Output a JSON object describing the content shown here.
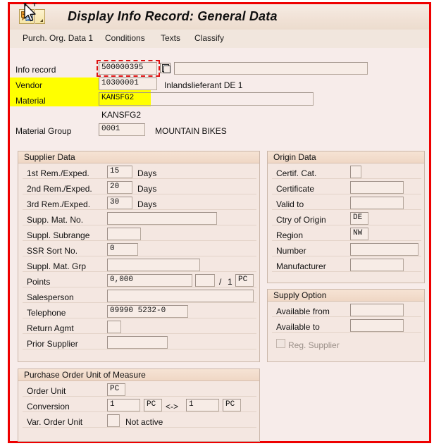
{
  "window": {
    "title": "Display Info Record: General Data",
    "system_icon": "sap-info-record-icon",
    "dropdown_icon": "chevron-down-icon"
  },
  "app_toolbar": {
    "items": [
      {
        "label": "Purch. Org. Data 1"
      },
      {
        "label": "Conditions"
      },
      {
        "label": "Texts"
      },
      {
        "label": "Classify"
      }
    ]
  },
  "header_fields": {
    "info_record": {
      "label": "Info record",
      "value": "500000395",
      "matchcode_icon": "matchcode-icon",
      "description": ""
    },
    "vendor": {
      "label": "Vendor",
      "value": "10300001",
      "description": "Inlandslieferant DE 1",
      "highlight": "#ffff00"
    },
    "material": {
      "label": "Material",
      "value": "KANSFG2",
      "description": "",
      "highlight": "#ffff00"
    },
    "material_text": "KANSFG2",
    "material_group": {
      "label": "Material Group",
      "value": "0001",
      "description": "MOUNTAIN BIKES"
    }
  },
  "supplier_data": {
    "title": "Supplier Data",
    "rows": [
      {
        "label": "1st Rem./Exped.",
        "value": "15",
        "suffix": "Days"
      },
      {
        "label": "2nd Rem./Exped.",
        "value": "20",
        "suffix": "Days"
      },
      {
        "label": "3rd Rem./Exped.",
        "value": "30",
        "suffix": "Days"
      },
      {
        "label": "Supp. Mat. No.",
        "value": "",
        "suffix": ""
      },
      {
        "label": "Suppl. Subrange",
        "value": "",
        "suffix": ""
      },
      {
        "label": "SSR Sort No.",
        "value": "0",
        "suffix": ""
      },
      {
        "label": "Suppl. Mat. Grp",
        "value": "",
        "suffix": ""
      },
      {
        "label": "Points",
        "value": "0,000",
        "suffix": ""
      },
      {
        "label": "Salesperson",
        "value": "",
        "suffix": ""
      },
      {
        "label": "Telephone",
        "value": "09990 5232-0",
        "suffix": ""
      },
      {
        "label": "Return Agmt",
        "value": "",
        "suffix": ""
      },
      {
        "label": "Prior Supplier",
        "value": "",
        "suffix": ""
      }
    ],
    "points_unit_value": "",
    "points_separator": "/",
    "points_denominator": "1",
    "points_uom": "PC"
  },
  "origin_data": {
    "title": "Origin Data",
    "rows": [
      {
        "label": "Certif. Cat.",
        "value": ""
      },
      {
        "label": "Certificate",
        "value": ""
      },
      {
        "label": "Valid to",
        "value": ""
      },
      {
        "label": "Ctry of Origin",
        "value": "DE"
      },
      {
        "label": "Region",
        "value": "NW"
      },
      {
        "label": "Number",
        "value": ""
      },
      {
        "label": "Manufacturer",
        "value": ""
      }
    ]
  },
  "supply_option": {
    "title": "Supply Option",
    "rows": [
      {
        "label": "Available from",
        "value": ""
      },
      {
        "label": "Available to",
        "value": ""
      }
    ],
    "checkbox": {
      "label": "Reg. Supplier",
      "checked": false,
      "enabled": false
    }
  },
  "po_unit_of_measure": {
    "title": "Purchase Order Unit of Measure",
    "order_unit": {
      "label": "Order Unit",
      "value": "PC"
    },
    "conversion": {
      "label": "Conversion",
      "numerator": "1",
      "numerator_uom": "PC",
      "operator": "<->",
      "denominator": "1",
      "denominator_uom": "PC"
    },
    "var_order_unit": {
      "label": "Var. Order Unit",
      "value": "",
      "status": "Not active"
    }
  },
  "colors": {
    "frame_red": "#ee0000",
    "highlight_yellow": "#ffff00",
    "focus_red": "#dd1111",
    "page_bg": "#f7ecea",
    "group_bg": "#f4e7e1",
    "field_bg": "#f7ece6"
  }
}
